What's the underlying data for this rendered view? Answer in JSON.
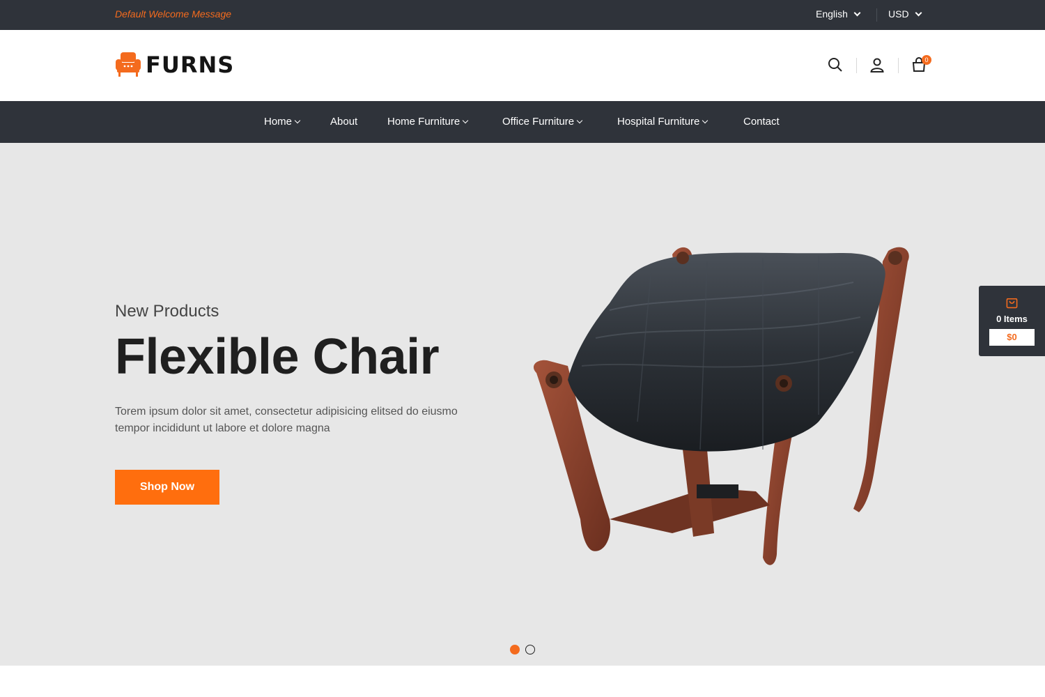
{
  "topbar": {
    "welcome": "Default Welcome Message",
    "language": "English",
    "currency": "USD"
  },
  "header": {
    "logo_text": "FURNS",
    "cart_count": "0",
    "icons": [
      "search-icon",
      "user-icon",
      "bag-icon"
    ]
  },
  "nav": {
    "items": [
      {
        "label": "Home",
        "has_dropdown": true
      },
      {
        "label": "About",
        "has_dropdown": false
      },
      {
        "label": "Home Furniture",
        "has_dropdown": true
      },
      {
        "label": "Office Furniture",
        "has_dropdown": true
      },
      {
        "label": "Hospital Furniture",
        "has_dropdown": true
      },
      {
        "label": "Contact",
        "has_dropdown": false
      }
    ]
  },
  "hero": {
    "subtitle": "New Products",
    "title": "Flexible Chair",
    "description": "Torem ipsum dolor sit amet, consectetur adipisicing elitsed do eiusmo tempor incididunt ut labore et dolore magna",
    "button": "Shop Now",
    "slides_count": 2,
    "active_slide": 1
  },
  "side_cart": {
    "items": "0 Items",
    "total": "$0"
  },
  "colors": {
    "accent": "#f46b1e",
    "dark_bar": "#2f333a",
    "hero_bg": "#e7e7e7"
  }
}
